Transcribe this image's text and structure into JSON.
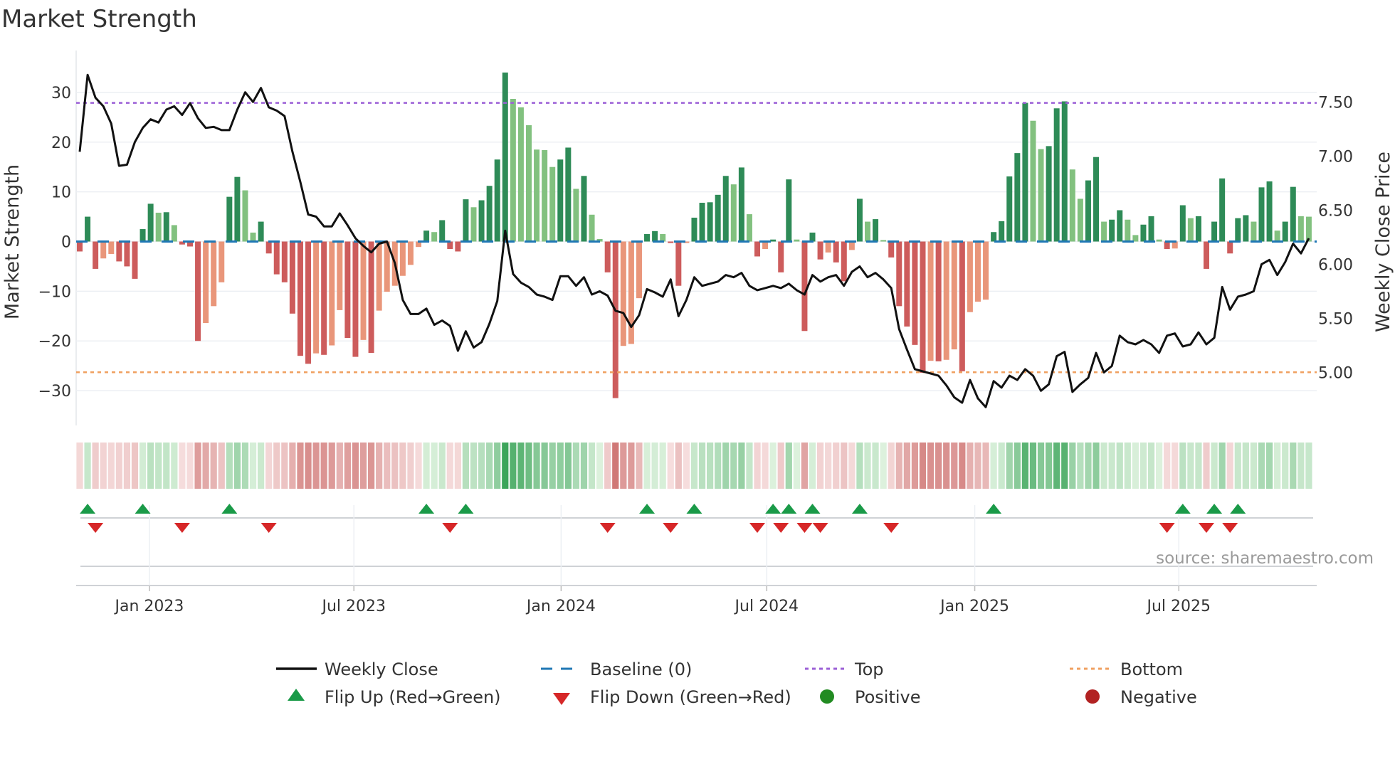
{
  "chart_data": {
    "type": "bar",
    "title": "Market Strength",
    "ylabel": "Market Strength",
    "y2label": "Weekly Close Price",
    "ylim": [
      -37,
      37
    ],
    "y2lim": [
      4.51,
      7.91
    ],
    "yticks": [
      30,
      20,
      10,
      0,
      -10,
      -20,
      -30
    ],
    "y2ticks": [
      "7.50",
      "7.00",
      "6.50",
      "6.00",
      "5.50",
      "5.00"
    ],
    "top_level": 27.9,
    "bottom_level": -26.3,
    "xticks": [
      {
        "label": "Jan 2023",
        "week": 8.85
      },
      {
        "label": "Jul 2023",
        "week": 34.8
      },
      {
        "label": "Jan 2024",
        "week": 61.1
      },
      {
        "label": "Jul 2024",
        "week": 87.2
      },
      {
        "label": "Jan 2025",
        "week": 113.6
      },
      {
        "label": "Jul 2025",
        "week": 139.5
      }
    ],
    "strength": [
      -2,
      5,
      -5.5,
      -3.4,
      -2.5,
      -4,
      -5,
      -7.5,
      2.5,
      7.6,
      5.8,
      5.9,
      3.3,
      -0.6,
      -1,
      -20,
      -16.4,
      -13,
      -8.2,
      9,
      13,
      10.3,
      1.8,
      4,
      -2.4,
      -6.6,
      -8.2,
      -14.5,
      -23,
      -24.6,
      -22.5,
      -22.8,
      -20.9,
      -13.8,
      -19.4,
      -23.2,
      -19.8,
      -22.4,
      -13.9,
      -10.1,
      -8.9,
      -6.9,
      -4.7,
      -1.1,
      2.2,
      1.9,
      4.3,
      -1.5,
      -2,
      8.5,
      6.9,
      8.3,
      11.2,
      16.5,
      34,
      28.7,
      27,
      23.4,
      18.5,
      18.4,
      15,
      16.5,
      18.9,
      10.6,
      13.2,
      5.4,
      0.5,
      -6.2,
      -31.5,
      -21,
      -20.6,
      -11.4,
      1.5,
      2.1,
      1.5,
      -0.3,
      -8.9,
      -0.3,
      4.8,
      7.8,
      7.9,
      9.4,
      13.2,
      11.5,
      14.9,
      5.5,
      -3,
      -1.5,
      0.4,
      -6.2,
      12.5,
      0.4,
      -18,
      1.8,
      -3.6,
      -2.2,
      -4.2,
      -8,
      -1.7,
      8.6,
      4,
      4.5,
      0.3,
      -3.2,
      -13,
      -17.1,
      -20.8,
      -26.4,
      -24,
      -24.1,
      -23.8,
      -21.7,
      -26.1,
      -14.2,
      -12.1,
      -11.7,
      1.9,
      4.1,
      13.1,
      17.8,
      27.9,
      24.3,
      18.6,
      19.2,
      26.8,
      28.2,
      14.5,
      8.6,
      12.3,
      17,
      4,
      4.4,
      6.3,
      4.4,
      1.3,
      3.4,
      5.1,
      0.4,
      -1.5,
      -1.4,
      7.3,
      4.7,
      5.1,
      -5.5,
      4,
      12.7,
      -2.4,
      4.7,
      5.3,
      4,
      10.9,
      12.1,
      2.2,
      4,
      11,
      5.1,
      5.0
    ],
    "weekly_close": [
      7.04,
      7.75,
      7.54,
      7.46,
      7.3,
      6.91,
      6.92,
      7.13,
      7.26,
      7.34,
      7.31,
      7.43,
      7.46,
      7.38,
      7.49,
      7.35,
      7.26,
      7.27,
      7.24,
      7.24,
      7.43,
      7.59,
      7.5,
      7.63,
      7.45,
      7.42,
      7.37,
      7.04,
      6.76,
      6.46,
      6.44,
      6.35,
      6.35,
      6.47,
      6.36,
      6.24,
      6.17,
      6.11,
      6.19,
      6.21,
      6.01,
      5.67,
      5.54,
      5.54,
      5.59,
      5.44,
      5.48,
      5.43,
      5.2,
      5.38,
      5.23,
      5.28,
      5.45,
      5.66,
      6.31,
      5.91,
      5.83,
      5.79,
      5.72,
      5.7,
      5.67,
      5.89,
      5.89,
      5.8,
      5.88,
      5.72,
      5.75,
      5.71,
      5.57,
      5.55,
      5.42,
      5.53,
      5.77,
      5.74,
      5.7,
      5.86,
      5.52,
      5.67,
      5.88,
      5.8,
      5.82,
      5.84,
      5.9,
      5.88,
      5.92,
      5.8,
      5.76,
      5.78,
      5.8,
      5.78,
      5.82,
      5.76,
      5.72,
      5.9,
      5.84,
      5.88,
      5.9,
      5.8,
      5.93,
      5.98,
      5.88,
      5.92,
      5.86,
      5.78,
      5.4,
      5.21,
      5.03,
      5.01,
      4.99,
      4.97,
      4.88,
      4.77,
      4.72,
      4.93,
      4.76,
      4.68,
      4.92,
      4.86,
      4.97,
      4.93,
      5.03,
      4.97,
      4.83,
      4.89,
      5.15,
      5.19,
      4.82,
      4.89,
      4.95,
      5.18,
      5.0,
      5.06,
      5.34,
      5.28,
      5.26,
      5.3,
      5.26,
      5.18,
      5.34,
      5.36,
      5.24,
      5.26,
      5.37,
      5.26,
      5.32,
      5.79,
      5.58,
      5.7,
      5.72,
      5.75,
      6.0,
      6.04,
      5.9,
      6.02,
      6.19,
      6.1,
      6.24
    ],
    "flip_up_weeks": [
      1,
      8,
      19,
      44,
      49,
      72,
      78,
      88,
      90,
      93,
      99,
      116,
      140,
      144,
      147
    ],
    "flip_down_weeks": [
      2,
      13,
      24,
      47,
      67,
      75,
      86,
      89,
      92,
      94,
      103,
      138,
      143,
      146
    ],
    "legend": {
      "weekly_close": "Weekly Close",
      "baseline": "Baseline (0)",
      "top": "Top",
      "bottom": "Bottom",
      "flip_up": "Flip Up (Red→Green)",
      "flip_down": "Flip Down (Green→Red)",
      "positive": "Positive",
      "negative": "Negative"
    },
    "legend_placement": "bottom",
    "source": "source: sharemaestro.com",
    "colors": {
      "pos_strong": "#2e8b57",
      "pos_weak": "#82c17f",
      "neg_strong": "#cd5c5c",
      "neg_weak": "#e9967a",
      "line": "#111111",
      "baseline": "#1f77b4",
      "top": "#9b5fd6",
      "bottom": "#f0a060",
      "flip_up": "#1a9a48",
      "flip_down": "#d62728",
      "positive": "#228b22",
      "negative": "#b22222"
    }
  }
}
